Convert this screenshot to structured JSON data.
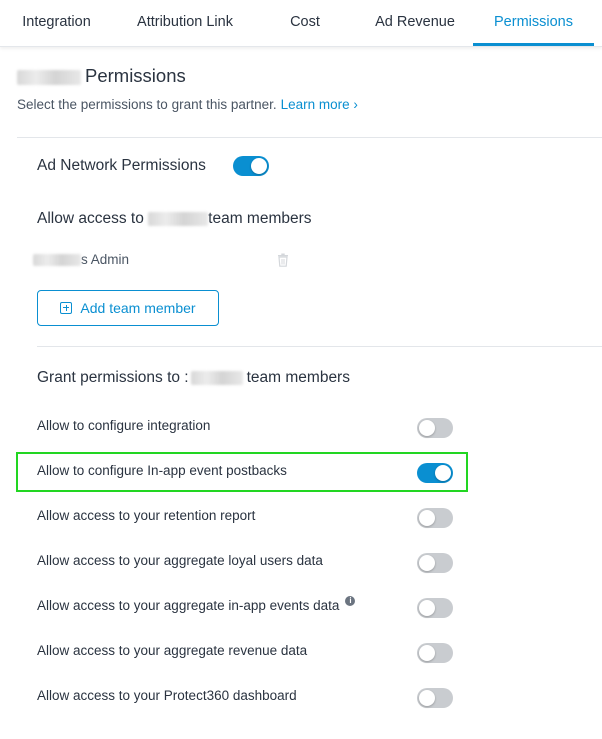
{
  "tabs": [
    {
      "label": "Integration",
      "active": false
    },
    {
      "label": "Attribution Link",
      "active": false
    },
    {
      "label": "Cost",
      "active": false
    },
    {
      "label": "Ad Revenue",
      "active": false
    },
    {
      "label": "Permissions",
      "active": true
    }
  ],
  "header": {
    "title": "Permissions",
    "subtitle": "Select the permissions to grant this partner.",
    "learn_more": "Learn more ›"
  },
  "ad_network": {
    "label": "Ad Network Permissions",
    "enabled": true
  },
  "team_access": {
    "title_prefix": "Allow access to",
    "title_suffix": "team members",
    "member_label": "s Admin",
    "add_button": "Add team member"
  },
  "grant": {
    "title_prefix": "Grant permissions to :",
    "title_suffix": "team members",
    "items": [
      {
        "label": "Allow to configure integration",
        "enabled": false
      },
      {
        "label": "Allow to configure In-app event postbacks",
        "enabled": true
      },
      {
        "label": "Allow access to your retention report",
        "enabled": false
      },
      {
        "label": "Allow access to your aggregate loyal users data",
        "enabled": false
      },
      {
        "label": "Allow access to your aggregate in-app events data",
        "enabled": false,
        "info": "i"
      },
      {
        "label": "Allow access to your aggregate revenue data",
        "enabled": false
      },
      {
        "label": "Allow access to your Protect360 dashboard",
        "enabled": false
      }
    ]
  },
  "colors": {
    "accent": "#0a8fd1",
    "toggle_off": "#c9ccd0",
    "highlight": "#22d622"
  }
}
